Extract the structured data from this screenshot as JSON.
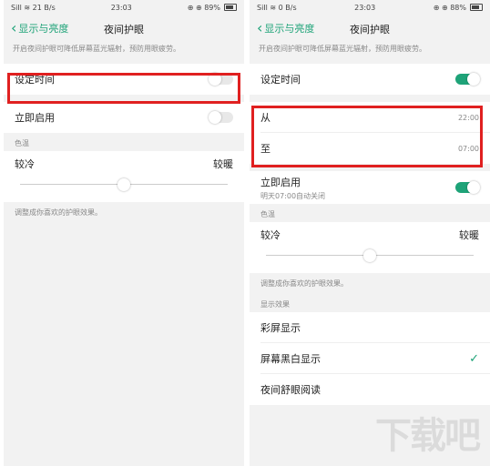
{
  "left": {
    "status": {
      "left": "SiIl ≋ 21 B/s",
      "time": "23:03",
      "right": "⊕ ⊕ 89%"
    },
    "back_label": "显示与亮度",
    "title": "夜间护眼",
    "description": "开启夜间护眼可降低屏幕蓝光辐射，预防用眼疲劳。",
    "schedule_label": "设定时间",
    "enable_now_label": "立即启用",
    "temp_header": "色温",
    "cool_label": "较冷",
    "warm_label": "较暖",
    "temp_level": 0.5,
    "note": "调整成你喜欢的护眼效果。"
  },
  "right": {
    "status": {
      "left": "SiIl ≋ 0 B/s",
      "time": "23:03",
      "right": "⊕ ⊕ 88%"
    },
    "back_label": "显示与亮度",
    "title": "夜间护眼",
    "description": "开启夜间护眼可降低屏幕蓝光辐射，预防用眼疲劳。",
    "schedule_label": "设定时间",
    "from_label": "从",
    "from_time": "22:00",
    "to_label": "至",
    "to_time": "07:00",
    "enable_now_label": "立即启用",
    "enable_now_sub": "明天07:00自动关闭",
    "temp_header": "色温",
    "cool_label": "较冷",
    "warm_label": "较暖",
    "temp_level": 0.5,
    "note": "调整成你喜欢的护眼效果。",
    "display_header": "显示效果",
    "display_options": [
      "彩屏显示",
      "屏幕黑白显示",
      "夜间舒眼阅读"
    ],
    "display_selected": "屏幕黑白显示"
  },
  "colors": {
    "accent": "#1ea378",
    "highlight": "#e02020"
  },
  "watermark": "下载吧"
}
